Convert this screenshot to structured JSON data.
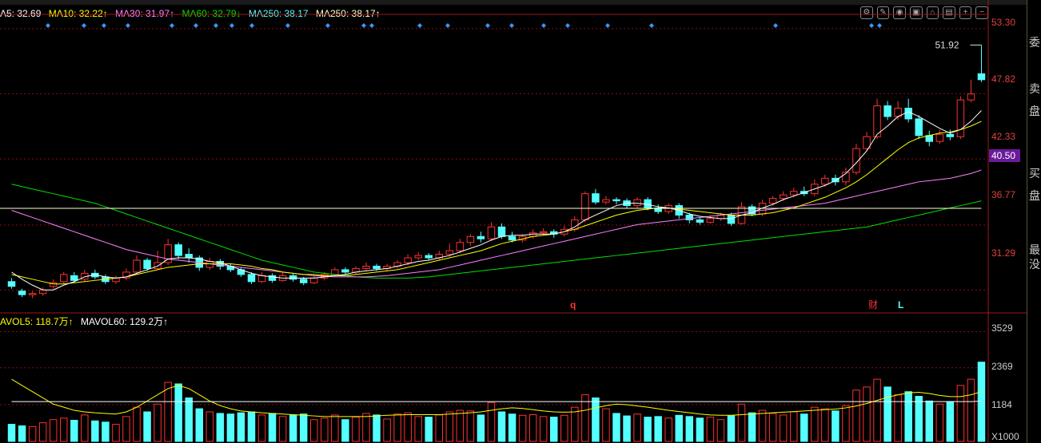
{
  "legend": {
    "ma5": "A5: 32.69",
    "ma10": "MA10: 32.22↑",
    "ma30": "MA30: 31.97↑",
    "ma60": "MA60: 32.79↓",
    "ma250a": "MA250: 38.17",
    "ma250b": "MA250: 38.17↑"
  },
  "vol_legend": {
    "mavol5": "AVOL5: 118.7万↑",
    "mavol60": "MAVOL60: 129.2万↑"
  },
  "price_axis": [
    "53.30",
    "47.82",
    "42.33",
    "36.77",
    "31.29"
  ],
  "current_price_badge": "40.50",
  "max_label": "51.92",
  "vol_axis": [
    "3529",
    "2369",
    "1184"
  ],
  "vol_unit": "X1000",
  "markers": {
    "q": "q",
    "cai": "财",
    "l": "L"
  },
  "side_chars": [
    "委",
    "卖",
    "盘",
    "买",
    "盘",
    "最",
    "没"
  ],
  "colors": {
    "up": "#ff3030",
    "down": "#54ffff",
    "ma5": "#ffffff",
    "ma10": "#ffff00",
    "ma30": "#ff80ff",
    "ma60": "#00e000",
    "ma250": "#ffffcc",
    "grid": "#8a1010"
  },
  "chart_data": {
    "type": "candlestick",
    "ylim": [
      29.5,
      54.5
    ],
    "candles": [
      [
        32.0,
        31.6,
        32.3,
        31.4,
        55
      ],
      [
        31.2,
        30.9,
        31.4,
        30.7,
        50
      ],
      [
        30.9,
        31.0,
        31.2,
        30.6,
        48
      ],
      [
        31.0,
        31.3,
        31.5,
        30.8,
        60
      ],
      [
        31.6,
        31.9,
        32.2,
        31.4,
        70
      ],
      [
        32.0,
        32.6,
        32.8,
        31.8,
        75
      ],
      [
        32.5,
        32.1,
        32.8,
        31.9,
        68
      ],
      [
        32.2,
        32.7,
        33.0,
        32.0,
        85
      ],
      [
        32.7,
        32.4,
        33.0,
        32.2,
        66
      ],
      [
        32.4,
        32.0,
        32.6,
        31.8,
        62
      ],
      [
        32.0,
        32.3,
        32.5,
        31.8,
        55
      ],
      [
        32.3,
        32.8,
        33.1,
        32.1,
        80
      ],
      [
        32.8,
        33.8,
        34.2,
        32.6,
        110
      ],
      [
        33.8,
        33.1,
        34.0,
        32.9,
        95
      ],
      [
        33.1,
        33.6,
        34.6,
        33.0,
        120
      ],
      [
        33.6,
        35.1,
        35.6,
        33.4,
        190
      ],
      [
        35.1,
        34.2,
        35.3,
        33.9,
        185
      ],
      [
        34.3,
        34.0,
        34.8,
        33.6,
        140
      ],
      [
        34.0,
        33.2,
        34.2,
        32.9,
        105
      ],
      [
        33.2,
        33.7,
        34.0,
        33.0,
        95
      ],
      [
        33.7,
        33.3,
        33.9,
        33.0,
        90
      ],
      [
        33.3,
        33.0,
        33.5,
        32.8,
        88
      ],
      [
        33.0,
        32.6,
        33.2,
        32.4,
        92
      ],
      [
        32.6,
        32.0,
        32.8,
        31.8,
        95
      ],
      [
        32.0,
        32.5,
        32.8,
        31.9,
        85
      ],
      [
        32.5,
        32.1,
        32.7,
        31.9,
        90
      ],
      [
        32.1,
        32.5,
        32.8,
        32.0,
        80
      ],
      [
        32.5,
        32.2,
        32.7,
        32.0,
        85
      ],
      [
        32.2,
        31.9,
        32.4,
        31.7,
        88
      ],
      [
        31.9,
        32.3,
        32.5,
        31.8,
        70
      ],
      [
        32.3,
        32.6,
        32.8,
        32.1,
        75
      ],
      [
        32.6,
        33.0,
        33.2,
        32.4,
        85
      ],
      [
        33.0,
        32.8,
        33.2,
        32.6,
        70
      ],
      [
        32.8,
        33.1,
        33.3,
        32.6,
        78
      ],
      [
        33.1,
        33.3,
        33.6,
        32.9,
        90
      ],
      [
        33.3,
        33.1,
        33.5,
        32.9,
        85
      ],
      [
        33.1,
        33.3,
        33.5,
        32.9,
        72
      ],
      [
        33.3,
        33.6,
        33.8,
        33.1,
        88
      ],
      [
        33.6,
        34.0,
        34.3,
        33.4,
        92
      ],
      [
        34.0,
        34.2,
        34.5,
        33.8,
        80
      ],
      [
        34.2,
        34.0,
        34.4,
        33.8,
        78
      ],
      [
        34.0,
        34.3,
        34.6,
        33.8,
        85
      ],
      [
        34.3,
        34.6,
        35.2,
        34.1,
        95
      ],
      [
        34.6,
        35.3,
        35.6,
        34.4,
        100
      ],
      [
        35.3,
        35.8,
        36.0,
        35.0,
        98
      ],
      [
        35.8,
        35.6,
        36.2,
        35.3,
        85
      ],
      [
        35.6,
        36.6,
        37.0,
        35.4,
        125
      ],
      [
        36.6,
        35.8,
        36.9,
        35.6,
        95
      ],
      [
        35.8,
        35.5,
        36.2,
        35.3,
        88
      ],
      [
        35.5,
        35.8,
        36.0,
        35.3,
        84
      ],
      [
        35.8,
        36.1,
        36.4,
        35.6,
        86
      ],
      [
        36.1,
        36.2,
        36.5,
        35.9,
        80
      ],
      [
        36.2,
        36.0,
        36.4,
        35.7,
        78
      ],
      [
        36.0,
        36.4,
        36.7,
        35.8,
        84
      ],
      [
        36.4,
        37.2,
        37.5,
        36.2,
        110
      ],
      [
        37.2,
        39.4,
        39.6,
        37.0,
        150
      ],
      [
        39.4,
        38.7,
        39.8,
        38.5,
        140
      ],
      [
        38.7,
        38.9,
        39.2,
        38.5,
        105
      ],
      [
        38.9,
        38.8,
        39.1,
        38.5,
        90
      ],
      [
        38.8,
        38.4,
        39.0,
        38.2,
        82
      ],
      [
        38.4,
        38.9,
        39.1,
        38.2,
        88
      ],
      [
        38.9,
        38.2,
        39.1,
        38.0,
        78
      ],
      [
        38.2,
        37.9,
        38.5,
        37.7,
        80
      ],
      [
        37.9,
        38.4,
        38.6,
        37.7,
        75
      ],
      [
        38.4,
        37.6,
        38.6,
        37.3,
        84
      ],
      [
        37.6,
        37.2,
        37.8,
        36.9,
        80
      ],
      [
        37.2,
        37.0,
        37.4,
        36.8,
        75
      ],
      [
        37.0,
        37.3,
        37.6,
        36.9,
        78
      ],
      [
        37.3,
        37.6,
        37.8,
        37.1,
        70
      ],
      [
        37.6,
        36.9,
        37.8,
        36.7,
        82
      ],
      [
        36.9,
        38.3,
        38.7,
        36.8,
        120
      ],
      [
        38.3,
        37.7,
        38.5,
        37.5,
        92
      ],
      [
        37.7,
        38.6,
        38.9,
        37.5,
        100
      ],
      [
        38.6,
        39.0,
        39.2,
        38.4,
        90
      ],
      [
        39.0,
        39.3,
        39.6,
        38.8,
        85
      ],
      [
        39.3,
        39.6,
        39.9,
        39.1,
        95
      ],
      [
        39.6,
        39.4,
        40.0,
        39.2,
        88
      ],
      [
        39.4,
        40.2,
        40.6,
        39.2,
        110
      ],
      [
        40.2,
        40.7,
        41.0,
        40.0,
        105
      ],
      [
        40.7,
        40.4,
        41.0,
        40.1,
        98
      ],
      [
        40.4,
        41.2,
        41.6,
        40.1,
        115
      ],
      [
        41.2,
        43.2,
        43.6,
        41.0,
        165
      ],
      [
        43.2,
        44.2,
        44.6,
        43.0,
        175
      ],
      [
        44.2,
        46.8,
        47.4,
        44.0,
        200
      ],
      [
        46.8,
        45.9,
        47.2,
        45.6,
        175
      ],
      [
        45.9,
        46.6,
        47.2,
        45.6,
        150
      ],
      [
        46.6,
        45.7,
        47.4,
        45.4,
        160
      ],
      [
        45.7,
        44.3,
        46.0,
        44.0,
        145
      ],
      [
        44.3,
        43.8,
        44.7,
        43.4,
        130
      ],
      [
        43.8,
        44.4,
        44.8,
        43.6,
        120
      ],
      [
        44.4,
        44.2,
        44.8,
        43.9,
        128
      ],
      [
        44.2,
        47.3,
        47.6,
        44.0,
        180
      ],
      [
        47.3,
        47.8,
        49.0,
        47.1,
        200
      ],
      [
        49.5,
        49.0,
        51.92,
        48.8,
        255
      ]
    ],
    "ma5": [
      32.8,
      32.2,
      31.7,
      31.3,
      31.3,
      31.7,
      32.0,
      32.4,
      32.6,
      32.4,
      32.3,
      32.4,
      32.7,
      33.0,
      33.3,
      33.9,
      34.0,
      34.0,
      33.9,
      33.7,
      33.6,
      33.3,
      33.0,
      32.7,
      32.5,
      32.4,
      32.3,
      32.3,
      32.3,
      32.3,
      32.4,
      32.5,
      32.6,
      32.8,
      32.9,
      33.0,
      33.1,
      33.3,
      33.5,
      33.7,
      33.8,
      34.0,
      34.2,
      34.5,
      34.8,
      35.1,
      35.5,
      35.8,
      35.9,
      35.9,
      36.0,
      36.0,
      36.0,
      36.2,
      36.6,
      37.2,
      37.6,
      38.0,
      38.4,
      38.6,
      38.6,
      38.5,
      38.3,
      38.2,
      38.0,
      37.7,
      37.5,
      37.4,
      37.3,
      37.3,
      37.6,
      37.8,
      38.2,
      38.5,
      38.9,
      39.2,
      39.5,
      39.8,
      40.1,
      40.5,
      41.1,
      42.0,
      43.0,
      44.4,
      45.1,
      45.9,
      46.3,
      45.9,
      45.4,
      44.9,
      44.5,
      44.8,
      45.5,
      46.4
    ],
    "ma10": [
      32.6,
      32.4,
      32.2,
      32.0,
      31.8,
      31.8,
      31.9,
      32.0,
      32.1,
      32.2,
      32.3,
      32.4,
      32.6,
      32.8,
      33.0,
      33.2,
      33.3,
      33.4,
      33.5,
      33.5,
      33.5,
      33.5,
      33.4,
      33.3,
      33.1,
      33.0,
      32.8,
      32.7,
      32.6,
      32.6,
      32.5,
      32.5,
      32.5,
      32.6,
      32.7,
      32.8,
      32.9,
      33.0,
      33.2,
      33.4,
      33.6,
      33.8,
      34.0,
      34.2,
      34.4,
      34.6,
      34.9,
      35.2,
      35.4,
      35.6,
      35.8,
      35.9,
      36.0,
      36.2,
      36.4,
      36.7,
      37.0,
      37.3,
      37.6,
      37.8,
      38.0,
      38.1,
      38.2,
      38.2,
      38.1,
      38.0,
      37.9,
      37.8,
      37.7,
      37.6,
      37.6,
      37.6,
      37.7,
      37.8,
      38.0,
      38.2,
      38.5,
      38.8,
      39.1,
      39.5,
      39.9,
      40.4,
      41.0,
      41.7,
      42.4,
      43.1,
      43.7,
      44.1,
      44.3,
      44.5,
      44.6,
      44.8,
      45.1,
      45.5
    ],
    "ma30": [
      38.0,
      37.7,
      37.4,
      37.1,
      36.8,
      36.5,
      36.2,
      35.9,
      35.6,
      35.3,
      35.0,
      34.7,
      34.5,
      34.3,
      34.1,
      33.9,
      33.8,
      33.7,
      33.6,
      33.5,
      33.4,
      33.3,
      33.2,
      33.1,
      33.0,
      32.9,
      32.8,
      32.7,
      32.6,
      32.5,
      32.45,
      32.4,
      32.4,
      32.4,
      32.4,
      32.45,
      32.5,
      32.6,
      32.7,
      32.8,
      32.9,
      33.0,
      33.2,
      33.4,
      33.6,
      33.8,
      34.0,
      34.2,
      34.4,
      34.6,
      34.8,
      35.0,
      35.2,
      35.4,
      35.6,
      35.8,
      36.0,
      36.2,
      36.4,
      36.6,
      36.8,
      36.9,
      37.0,
      37.1,
      37.2,
      37.3,
      37.4,
      37.5,
      37.6,
      37.7,
      37.8,
      37.9,
      38.0,
      38.1,
      38.2,
      38.3,
      38.4,
      38.5,
      38.6,
      38.8,
      39.0,
      39.2,
      39.4,
      39.6,
      39.8,
      40.0,
      40.2,
      40.4,
      40.5,
      40.6,
      40.7,
      40.9,
      41.1,
      41.4
    ],
    "ma60": [
      40.2,
      40.0,
      39.8,
      39.6,
      39.4,
      39.2,
      39.0,
      38.8,
      38.6,
      38.3,
      38.0,
      37.7,
      37.4,
      37.1,
      36.8,
      36.5,
      36.2,
      35.9,
      35.6,
      35.3,
      35.0,
      34.7,
      34.4,
      34.1,
      33.8,
      33.6,
      33.4,
      33.2,
      33.0,
      32.8,
      32.7,
      32.6,
      32.5,
      32.4,
      32.35,
      32.3,
      32.3,
      32.3,
      32.3,
      32.35,
      32.4,
      32.5,
      32.6,
      32.7,
      32.8,
      32.9,
      33.0,
      33.1,
      33.2,
      33.3,
      33.4,
      33.5,
      33.6,
      33.7,
      33.8,
      33.9,
      34.0,
      34.1,
      34.2,
      34.3,
      34.4,
      34.5,
      34.6,
      34.7,
      34.8,
      34.9,
      35.0,
      35.1,
      35.2,
      35.3,
      35.4,
      35.5,
      35.6,
      35.7,
      35.8,
      35.9,
      36.0,
      36.1,
      36.2,
      36.3,
      36.4,
      36.5,
      36.6,
      36.8,
      37.0,
      37.2,
      37.4,
      37.6,
      37.8,
      38.0,
      38.2,
      38.4,
      38.6,
      38.8
    ],
    "ma250": 38.17,
    "mavol5": [
      200,
      180,
      160,
      140,
      120,
      110,
      100,
      95,
      92,
      90,
      88,
      95,
      110,
      130,
      150,
      170,
      180,
      170,
      150,
      130,
      115,
      105,
      98,
      95,
      92,
      90,
      88,
      86,
      84,
      82,
      80,
      80,
      80,
      80,
      80,
      82,
      84,
      85,
      86,
      86,
      86,
      86,
      88,
      90,
      92,
      95,
      100,
      105,
      108,
      106,
      102,
      98,
      95,
      94,
      95,
      100,
      108,
      115,
      120,
      118,
      114,
      110,
      105,
      100,
      96,
      92,
      88,
      85,
      84,
      84,
      86,
      88,
      90,
      92,
      94,
      96,
      98,
      100,
      102,
      104,
      108,
      114,
      122,
      132,
      142,
      150,
      156,
      158,
      154,
      148,
      144,
      144,
      150,
      160
    ],
    "mavol60": [
      128,
      128,
      128,
      128,
      128,
      128,
      128,
      128,
      128,
      128,
      128,
      128,
      128,
      128,
      128,
      128,
      128,
      128,
      128,
      128,
      128,
      128,
      128,
      128,
      128,
      128,
      128,
      128,
      128,
      128,
      128,
      128,
      128,
      128,
      128,
      128,
      128,
      128,
      128,
      128,
      128,
      128,
      128,
      128,
      128,
      128,
      128,
      128,
      128,
      128,
      128,
      128,
      128,
      128,
      128,
      128,
      128,
      128,
      128,
      128,
      128,
      128,
      128,
      128,
      128,
      128,
      128,
      128,
      128,
      128,
      128,
      128,
      128,
      128,
      128,
      128,
      128,
      128,
      128,
      128,
      128,
      128,
      128,
      128,
      128,
      128,
      128,
      128,
      128,
      128,
      128,
      128,
      128,
      129.2
    ],
    "vol_ylim": [
      0,
      3800
    ]
  }
}
